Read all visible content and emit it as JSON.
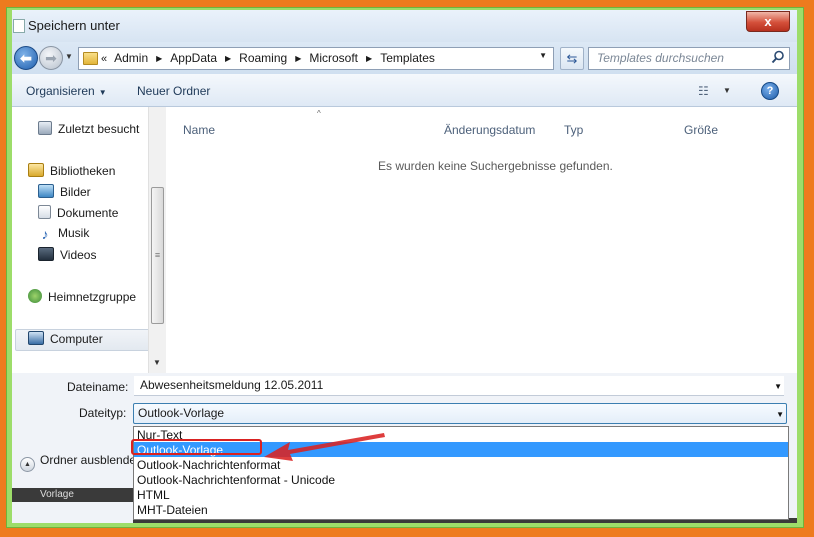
{
  "window": {
    "title": "Speichern unter",
    "close_glyph": "x"
  },
  "address": {
    "back_glyph": "⬅",
    "forward_glyph": "➡",
    "history_glyph": "▼",
    "lead_glyph": "«",
    "separator_glyph": "▶",
    "crumbs": [
      "Admin",
      "AppData",
      "Roaming",
      "Microsoft",
      "Templates"
    ],
    "dropdown_glyph": "▼",
    "refresh_glyph": "⇆",
    "search_placeholder": "Templates durchsuchen",
    "search_icon": "magnifier-icon"
  },
  "toolbar": {
    "organize_label": "Organisieren",
    "organize_chevron": "▼",
    "new_folder_label": "Neuer Ordner",
    "view_glyph": "☷",
    "view_dropdown_glyph": "▼",
    "help_glyph": "?"
  },
  "navigation": {
    "recent": "Zuletzt besucht",
    "libraries": "Bibliotheken",
    "pictures": "Bilder",
    "documents": "Dokumente",
    "music": "Musik",
    "music_glyph": "♪",
    "videos": "Videos",
    "homegroup": "Heimnetzgruppe",
    "computer": "Computer",
    "scroll_grip": "≡",
    "scroll_down_glyph": "▼"
  },
  "content": {
    "sort_caret": "^",
    "columns": {
      "name": "Name",
      "date": "Änderungsdatum",
      "type": "Typ",
      "size": "Größe"
    },
    "empty_message": "Es wurden keine Suchergebnisse gefunden."
  },
  "fields": {
    "filename_label": "Dateiname:",
    "filename_value": "Abwesenheitsmeldung 12.05.2011",
    "filetype_label": "Dateityp:",
    "filetype_value": "Outlook-Vorlage",
    "dropdown_glyph": "▼",
    "hide_folders_glyph": "▲",
    "hide_folders_label": "Ordner ausblende",
    "status_text": "Vorlage"
  },
  "filetype_options": [
    "Nur-Text",
    "Outlook-Vorlage",
    "Outlook-Nachrichtenformat",
    "Outlook-Nachrichtenformat - Unicode",
    "HTML",
    "MHT-Dateien"
  ],
  "selected_option_index": 1,
  "colors": {
    "outer_border": "#ee7b1e",
    "inner_border": "#9ddd6a",
    "selection": "#3399ff",
    "annotation": "#d92222"
  }
}
